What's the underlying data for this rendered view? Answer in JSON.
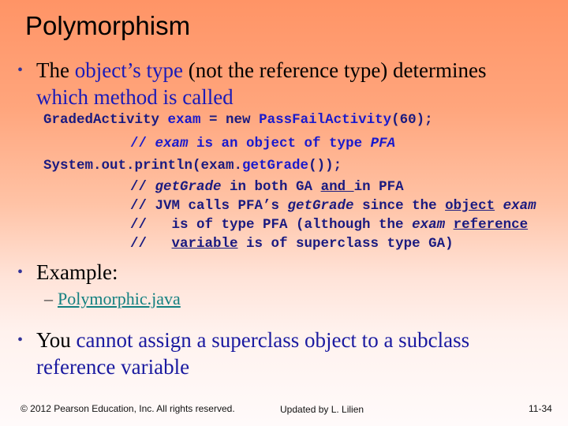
{
  "slide": {
    "title": "Polymorphism",
    "bullet1": {
      "t1": "The ",
      "t2": "object’s type",
      "t3": " (not the reference type) determines",
      "t4": "which method is called"
    },
    "code": {
      "line1": {
        "a": "GradedActivity ",
        "b": "exam",
        "c": " = new ",
        "d": "PassFailActivity",
        "e": "(60);"
      },
      "line2": {
        "a": "// ",
        "b": "exam",
        "c": " is an object of type ",
        "d": "PFA"
      },
      "line3": {
        "a": "System.out.println(exam.",
        "b": "getGrade",
        "c": "());"
      },
      "line4": {
        "a": "// ",
        "b": "getGrade",
        "c": " in both GA ",
        "d": "and ",
        "e": "in PFA"
      },
      "line5": {
        "a": "// JVM calls PFA’s ",
        "b": "getGrade",
        "c": " since the ",
        "d": "object",
        "e": " ",
        "f": "exam"
      },
      "line6": {
        "a": "//   is of type PFA (although the ",
        "b": "exam",
        "c": " ",
        "d": "reference"
      },
      "line7": {
        "a": "//   ",
        "b": "variable",
        "c": " is of superclass type GA)"
      }
    },
    "bullet2": "Example:",
    "sub_dash": "–",
    "sub_link": "Polymorphic.java",
    "bullet3": {
      "t1": "You ",
      "t2": "cannot assign a superclass object to a subclass",
      "t3": "reference variable"
    },
    "bullet_char": "•"
  },
  "footer": {
    "copyright": "© 2012 Pearson Education, Inc. All rights reserved.",
    "updated": "Updated by L. Lilien",
    "page": "11-34"
  }
}
